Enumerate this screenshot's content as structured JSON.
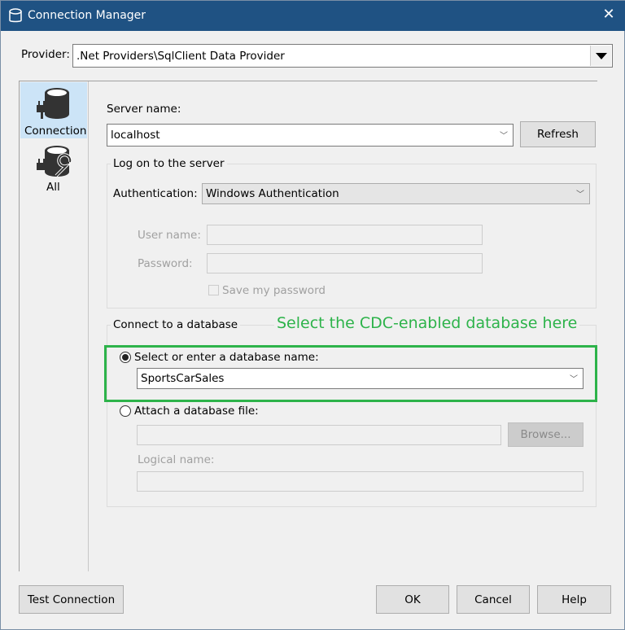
{
  "window": {
    "title": "Connection Manager",
    "close_glyph": "✕"
  },
  "provider": {
    "label": "Provider:",
    "value": ".Net Providers\\SqlClient Data Provider"
  },
  "sidebar": {
    "items": [
      {
        "label": "Connection",
        "selected": true
      },
      {
        "label": "All",
        "selected": false
      }
    ]
  },
  "server": {
    "label": "Server name:",
    "value": "localhost",
    "refresh_label": "Refresh"
  },
  "logon": {
    "title": "Log on to the server",
    "auth_label": "Authentication:",
    "auth_value": "Windows Authentication",
    "username_label": "User name:",
    "username_value": "",
    "password_label": "Password:",
    "password_value": "",
    "save_password_label": "Save my password",
    "save_password_checked": false
  },
  "database": {
    "title": "Connect to a database",
    "annotation": "Select the CDC-enabled database here",
    "annotation_color": "#2db34a",
    "select_label": "Select or enter a database name:",
    "select_value": "SportsCarSales",
    "attach_label": "Attach a database file:",
    "attach_value": "",
    "browse_label": "Browse...",
    "logical_name_label": "Logical name:",
    "logical_name_value": ""
  },
  "footer": {
    "test_label": "Test Connection",
    "ok_label": "OK",
    "cancel_label": "Cancel",
    "help_label": "Help"
  }
}
